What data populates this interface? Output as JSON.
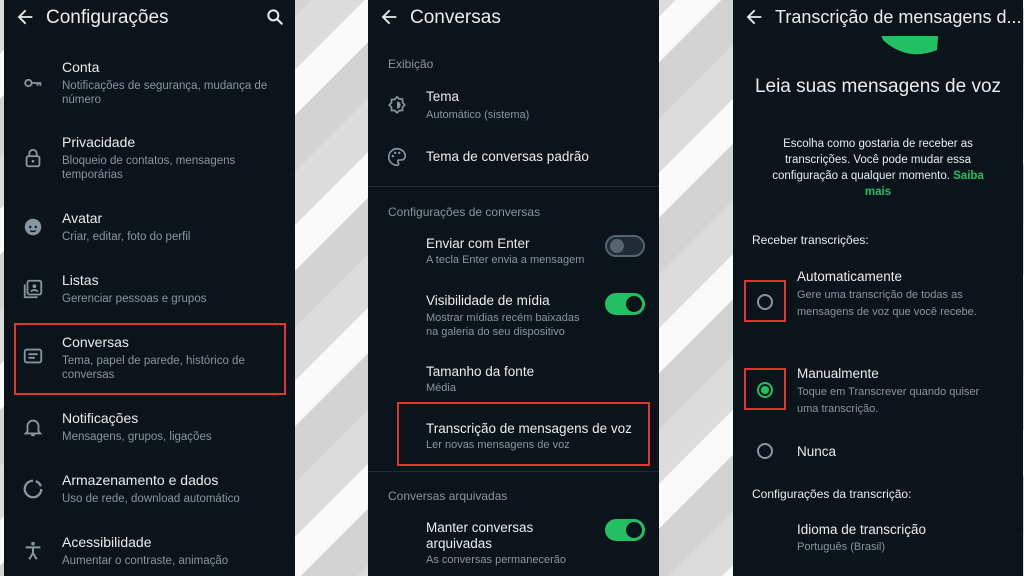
{
  "screen1": {
    "title": "Configurações",
    "items": [
      {
        "title": "Conta",
        "subtitle": "Notificações de segurança, mudança de número",
        "icon": "key-icon"
      },
      {
        "title": "Privacidade",
        "subtitle": "Bloqueio de contatos, mensagens temporárias",
        "icon": "lock-icon"
      },
      {
        "title": "Avatar",
        "subtitle": "Criar, editar, foto do perfil",
        "icon": "avatar-icon"
      },
      {
        "title": "Listas",
        "subtitle": "Gerenciar pessoas e grupos",
        "icon": "list-icon"
      },
      {
        "title": "Conversas",
        "subtitle": "Tema, papel de parede, histórico de conversas",
        "icon": "chat-icon"
      },
      {
        "title": "Notificações",
        "subtitle": "Mensagens, grupos, ligações",
        "icon": "bell-icon"
      },
      {
        "title": "Armazenamento e dados",
        "subtitle": "Uso de rede, download automático",
        "icon": "storage-icon"
      },
      {
        "title": "Acessibilidade",
        "subtitle": "Aumentar o contraste, animação",
        "icon": "accessibility-icon"
      }
    ]
  },
  "screen2": {
    "title": "Conversas",
    "section_display": "Exibição",
    "theme_title": "Tema",
    "theme_sub": "Automático (sistema)",
    "default_theme": "Tema de conversas padrão",
    "section_chat": "Configurações de conversas",
    "enter_title": "Enviar com Enter",
    "enter_sub": "A tecla Enter envia a mensagem",
    "media_title": "Visibilidade de mídia",
    "media_sub": "Mostrar mídias recém baixadas na galeria do seu dispositivo",
    "font_title": "Tamanho da fonte",
    "font_sub": "Média",
    "transcription_title": "Transcrição de mensagens de voz",
    "transcription_sub": "Ler novas mensagens de voz",
    "section_archived": "Conversas arquivadas",
    "archived_title": "Manter conversas arquivadas",
    "archived_sub": "As conversas permanecerão"
  },
  "screen3": {
    "title": "Transcrição de mensagens d...",
    "heading": "Leia suas mensagens de voz",
    "description": "Escolha como gostaria de receber as transcrições. Você pode mudar essa configuração a qualquer momento.",
    "learn_more": "Saiba mais",
    "receive_label": "Receber transcrições:",
    "options": [
      {
        "title": "Automaticamente",
        "subtitle": "Gere uma transcrição de todas as mensagens de voz que você recebe."
      },
      {
        "title": "Manualmente",
        "subtitle": "Toque em Transcrever quando quiser uma transcrição."
      },
      {
        "title": "Nunca",
        "subtitle": ""
      }
    ],
    "settings_label": "Configurações da transcrição:",
    "language_title": "Idioma de transcrição",
    "language_sub": "Português (Brasil)"
  },
  "colors": {
    "accent": "#21c063",
    "highlight": "#e0362b",
    "background": "#0b141a"
  }
}
